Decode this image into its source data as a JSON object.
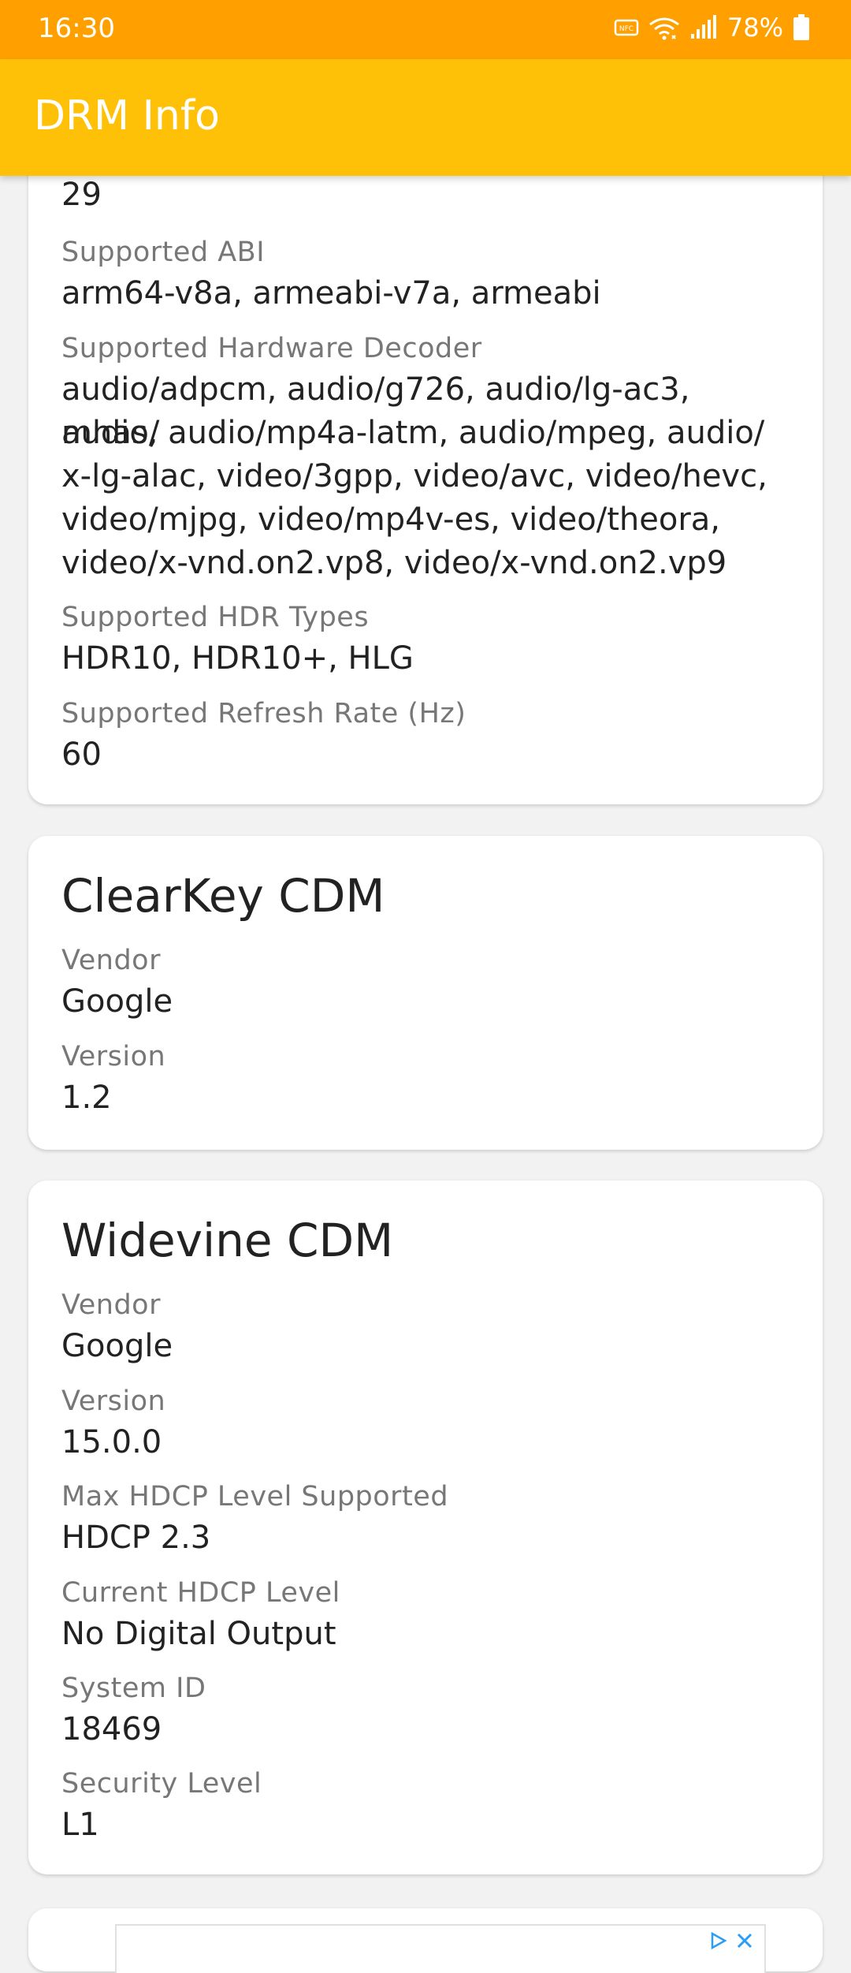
{
  "status_bar": {
    "time": "16:30",
    "battery": "78%",
    "icons": [
      "nfc-icon",
      "wifi-icon",
      "signal-icon",
      "battery-icon"
    ]
  },
  "app_bar": {
    "title": "DRM Info"
  },
  "device_card": {
    "partial_value": "29",
    "fields": [
      {
        "label": "Supported ABI",
        "value": "arm64-v8a, armeabi-v7a, armeabi"
      },
      {
        "label": "Supported Hardware Decoder",
        "value_lines": [
          "audio/adpcm, audio/g726, audio/lg-ac3, audio/",
          "mhas, audio/mp4a-latm, audio/mpeg, audio/",
          "x-lg-alac, video/3gpp, video/avc, video/hevc,",
          "video/mjpg, video/mp4v-es, video/theora,",
          "video/x-vnd.on2.vp8, video/x-vnd.on2.vp9"
        ]
      },
      {
        "label": "Supported HDR Types",
        "value": "HDR10, HDR10+, HLG"
      },
      {
        "label": "Supported Refresh Rate (Hz)",
        "value": "60"
      }
    ]
  },
  "clearkey_card": {
    "title": "ClearKey CDM",
    "fields": [
      {
        "label": "Vendor",
        "value": "Google"
      },
      {
        "label": "Version",
        "value": "1.2"
      }
    ]
  },
  "widevine_card": {
    "title": "Widevine CDM",
    "fields": [
      {
        "label": "Vendor",
        "value": "Google"
      },
      {
        "label": "Version",
        "value": "15.0.0"
      },
      {
        "label": "Max HDCP Level Supported",
        "value": "HDCP 2.3"
      },
      {
        "label": "Current HDCP Level",
        "value": "No Digital Output"
      },
      {
        "label": "System ID",
        "value": "18469"
      },
      {
        "label": "Security Level",
        "value": "L1"
      }
    ]
  },
  "ad": {
    "icons": [
      "ad-choices-icon",
      "close-icon"
    ]
  },
  "colors": {
    "status_bar": "#ffa000",
    "app_bar": "#ffc107",
    "background": "#f2f2f2",
    "card": "#ffffff"
  }
}
